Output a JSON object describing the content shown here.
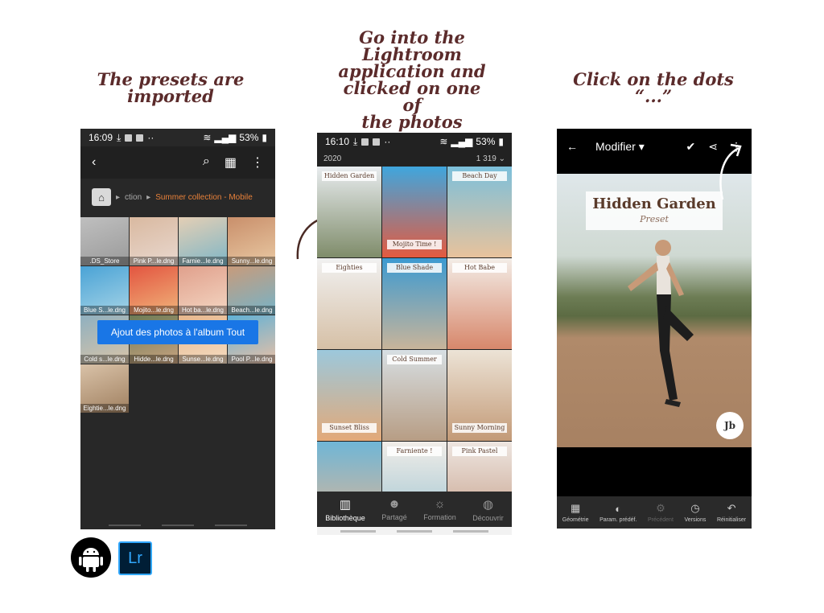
{
  "captions": {
    "left": "The presets are\nimported",
    "middle": "Go into the\nLightroom\napplication and\nclicked on one of\nthe photos",
    "right": "Click on the dots\n“...”"
  },
  "phone1": {
    "time": "16:09",
    "battery": "53%",
    "breadcrumb_prefix": "ction",
    "breadcrumb_current": "Summer collection - Mobile",
    "files": [
      {
        "label": ".DS_Store",
        "colors": [
          "#bfbfbf",
          "#9a9a9a"
        ]
      },
      {
        "label": "Pink P...le.dng",
        "colors": [
          "#d9b9a0",
          "#e9d8cf"
        ]
      },
      {
        "label": "Farnie...le.dng",
        "colors": [
          "#e4cfb5",
          "#7fb6c6"
        ]
      },
      {
        "label": "Sunny...le.dng",
        "colors": [
          "#c98f6b",
          "#e9c9a3"
        ]
      },
      {
        "label": "Blue S...le.dng",
        "colors": [
          "#4aa3d6",
          "#a4d3e6"
        ]
      },
      {
        "label": "Mojito...le.dng",
        "colors": [
          "#e35540",
          "#f0b37a"
        ]
      },
      {
        "label": "Hot ba...le.dng",
        "colors": [
          "#e0a08c",
          "#f4d6c2"
        ]
      },
      {
        "label": "Beach...le.dng",
        "colors": [
          "#c89b7b",
          "#75b3c8"
        ]
      },
      {
        "label": "Cold s...le.dng",
        "colors": [
          "#8fb0c0",
          "#d8c4a8"
        ]
      },
      {
        "label": "Hidde...le.dng",
        "colors": [
          "#6c7b56",
          "#c7a27f"
        ]
      },
      {
        "label": "Sunse...le.dng",
        "colors": [
          "#e7b78d",
          "#f4dbc0"
        ]
      },
      {
        "label": "Pool P...le.dng",
        "colors": [
          "#5fb1d6",
          "#e9c0a6"
        ]
      },
      {
        "label": "Eightie...le.dng",
        "colors": [
          "#d9c2a8",
          "#a08060"
        ]
      }
    ],
    "album_button": "Ajout des photos à l'album Tout"
  },
  "phone2": {
    "time": "16:10",
    "battery": "53%",
    "year": "2020",
    "count": "1 319",
    "photos": [
      {
        "label": "Hidden Garden",
        "pos": "top",
        "colors": [
          "#e8ecef",
          "#7f8c6a"
        ]
      },
      {
        "label": "",
        "pos": "top",
        "colors": [
          "#3fa6de",
          "#e45a3f"
        ]
      },
      {
        "label": "Beach Day",
        "pos": "top",
        "colors": [
          "#7cc0db",
          "#e8c29c"
        ]
      },
      {
        "label": "Eighties",
        "pos": "top",
        "colors": [
          "#f1f1f1",
          "#d6c0a6"
        ]
      },
      {
        "label": "Blue Shade",
        "pos": "top",
        "colors": [
          "#3c9ad1",
          "#c8b49a"
        ]
      },
      {
        "label": "Hot Babe",
        "pos": "top",
        "colors": [
          "#f3ede7",
          "#d7876b"
        ]
      },
      {
        "label": "Sunset Bliss",
        "pos": "bottom",
        "colors": [
          "#9cc8dc",
          "#e3a978"
        ]
      },
      {
        "label": "Cold Summer",
        "pos": "top",
        "colors": [
          "#d7dfe3",
          "#b79d84"
        ]
      },
      {
        "label": "Sunny Morning",
        "pos": "bottom",
        "colors": [
          "#ece3d6",
          "#c39a77"
        ]
      },
      {
        "label": "",
        "pos": "top",
        "colors": [
          "#6fb6d6",
          "#e3b594"
        ]
      },
      {
        "label": "Farniente !",
        "pos": "top",
        "colors": [
          "#f1ede8",
          "#9bc3d1"
        ]
      },
      {
        "label": "Pink Pastel",
        "pos": "top",
        "colors": [
          "#eee6e1",
          "#c49d86"
        ]
      }
    ],
    "mojito_label": "Mojito Time !",
    "tabs": [
      "Bibliothèque",
      "Partagé",
      "Formation",
      "Découvrir"
    ]
  },
  "phone3": {
    "title": "Modifier",
    "hg_title": "Hidden Garden",
    "hg_sub": "Preset",
    "badge": "Jb",
    "tools": [
      "Géométrie",
      "Param. prédéf.",
      "Précédent",
      "Versions",
      "Réinitialiser"
    ]
  },
  "logos": {
    "lightroom": "Lr"
  },
  "colors": {
    "caption": "#5b2b2b",
    "accent_blue": "#1976e6",
    "accent_orange": "#e8813a"
  }
}
